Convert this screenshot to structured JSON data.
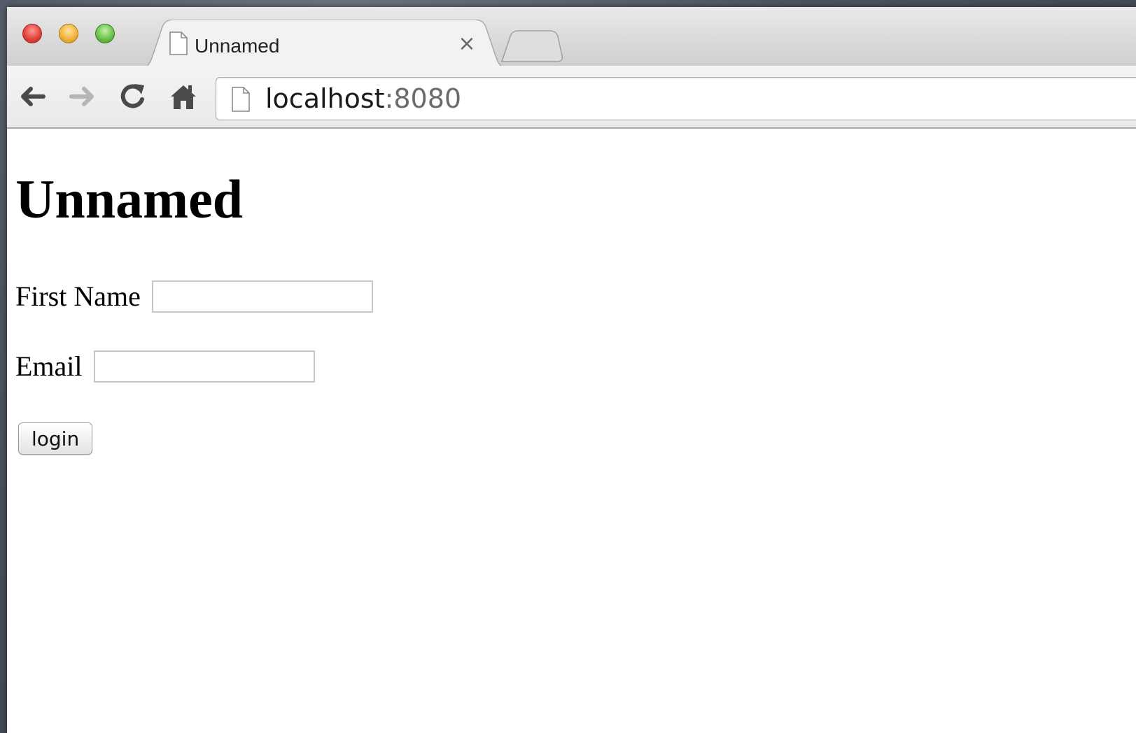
{
  "browser": {
    "tab": {
      "title": "Unnamed",
      "close_glyph": "×",
      "icon": "page-icon"
    },
    "new_tab": {
      "icon": "new-tab-icon"
    },
    "toolbar": {
      "back_icon": "back-arrow-icon",
      "forward_icon": "forward-arrow-icon",
      "reload_icon": "reload-icon",
      "home_icon": "home-icon"
    },
    "omnibox": {
      "host": "localhost",
      "port": ":8080",
      "icon": "page-icon"
    },
    "window_controls": [
      "close",
      "minimize",
      "zoom"
    ]
  },
  "page": {
    "title": "Unnamed",
    "form": {
      "first_name_label": "First Name",
      "first_name_value": "",
      "email_label": "Email",
      "email_value": "",
      "login_label": "login"
    }
  },
  "colors": {
    "close": "#e0443a",
    "minimize": "#f3b43c",
    "zoom": "#6cc34a",
    "page_background": "#ffffff"
  }
}
